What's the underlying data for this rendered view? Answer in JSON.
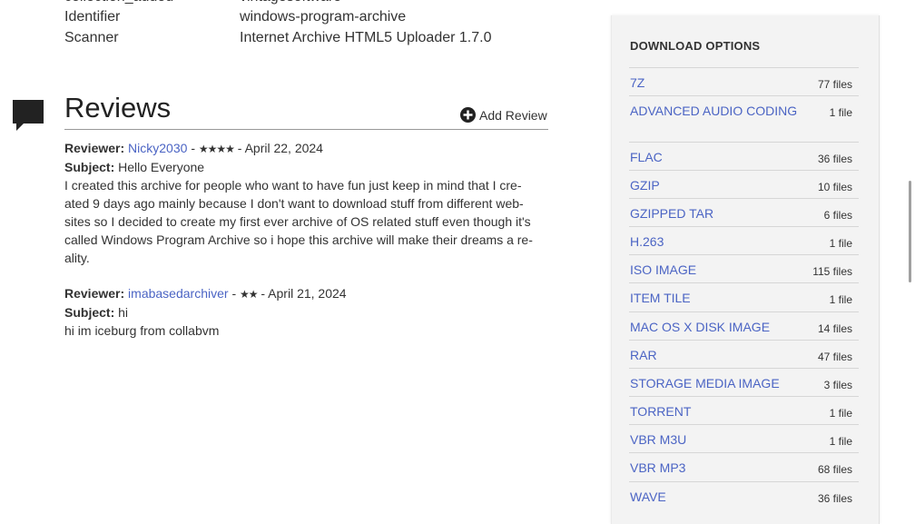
{
  "metadata": [
    {
      "label": "collection_added",
      "value": "vintagesoftware"
    },
    {
      "label": "Identifier",
      "value": "windows-program-archive"
    },
    {
      "label": "Scanner",
      "value": "Internet Archive HTML5 Uploader 1.7.0"
    }
  ],
  "reviews": {
    "title": "Reviews",
    "add_review": "Add Review",
    "items": [
      {
        "reviewer_label": "Reviewer:",
        "reviewer": "Nicky2030",
        "stars": "★★★★",
        "date": "- April 22, 2024",
        "subject_label": "Subject:",
        "subject": "Hello Everyone",
        "body_lines": [
          "I created this archive for people who want to have fun just keep in mind that I cre-",
          "ated 9 days ago mainly because I don't want to download stuff from different web-",
          "sites so I decided to create my first ever archive of OS related stuff even though it's",
          "called Windows Program Archive so i hope this archive will make their dreams a re-",
          "ality."
        ]
      },
      {
        "reviewer_label": "Reviewer:",
        "reviewer": "imabasedarchiver",
        "stars": "★★",
        "date": "- April 21, 2024",
        "subject_label": "Subject:",
        "subject": "hi",
        "body_lines": [
          "hi im iceburg from collabvm"
        ]
      }
    ]
  },
  "download_options": {
    "title": "DOWNLOAD OPTIONS",
    "items": [
      {
        "name": "7Z",
        "count": "77 files"
      },
      {
        "name": "ADVANCED AUDIO CODING",
        "count": "1 file"
      },
      {
        "name": "FLAC",
        "count": "36 files"
      },
      {
        "name": "GZIP",
        "count": "10 files"
      },
      {
        "name": "GZIPPED TAR",
        "count": "6 files"
      },
      {
        "name": "H.263",
        "count": "1 file"
      },
      {
        "name": "ISO IMAGE",
        "count": "115 files"
      },
      {
        "name": "ITEM TILE",
        "count": "1 file"
      },
      {
        "name": "MAC OS X DISK IMAGE",
        "count": "14 files"
      },
      {
        "name": "RAR",
        "count": "47 files"
      },
      {
        "name": "STORAGE MEDIA IMAGE",
        "count": "3 files"
      },
      {
        "name": "TORRENT",
        "count": "1 file"
      },
      {
        "name": "VBR M3U",
        "count": "1 file"
      },
      {
        "name": "VBR MP3",
        "count": "68 files"
      },
      {
        "name": "WAVE",
        "count": "36 files"
      }
    ]
  }
}
